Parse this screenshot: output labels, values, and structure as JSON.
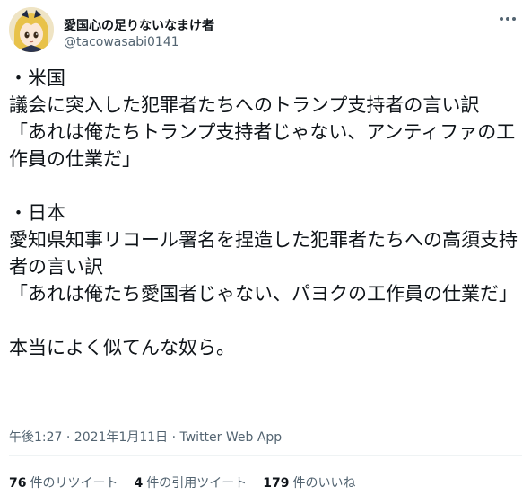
{
  "user": {
    "display_name": "愛国心の足りないなまけ者",
    "handle": "@tacowasabi0141"
  },
  "tweet": {
    "text": "・米国\n議会に突入した犯罪者たちへのトランプ支持者の言い訳\n「あれは俺たちトランプ支持者じゃない、アンティファの工作員の仕業だ」\n\n・日本\n愛知県知事リコール署名を捏造した犯罪者たちへの高須支持者の言い訳\n「あれは俺たち愛国者じゃない、パヨクの工作員の仕業だ」\n\n本当によく似てんな奴ら。",
    "timestamp": "午後1:27 · 2021年1月11日 · Twitter Web App"
  },
  "stats": {
    "retweets_count": "76",
    "retweets_label": "件のリツイート",
    "quotes_count": "4",
    "quotes_label": "件の引用ツイート",
    "likes_count": "179",
    "likes_label": "件のいいね"
  },
  "icons": {
    "more": "more-horizontal-icon",
    "avatar": "avatar-image"
  }
}
